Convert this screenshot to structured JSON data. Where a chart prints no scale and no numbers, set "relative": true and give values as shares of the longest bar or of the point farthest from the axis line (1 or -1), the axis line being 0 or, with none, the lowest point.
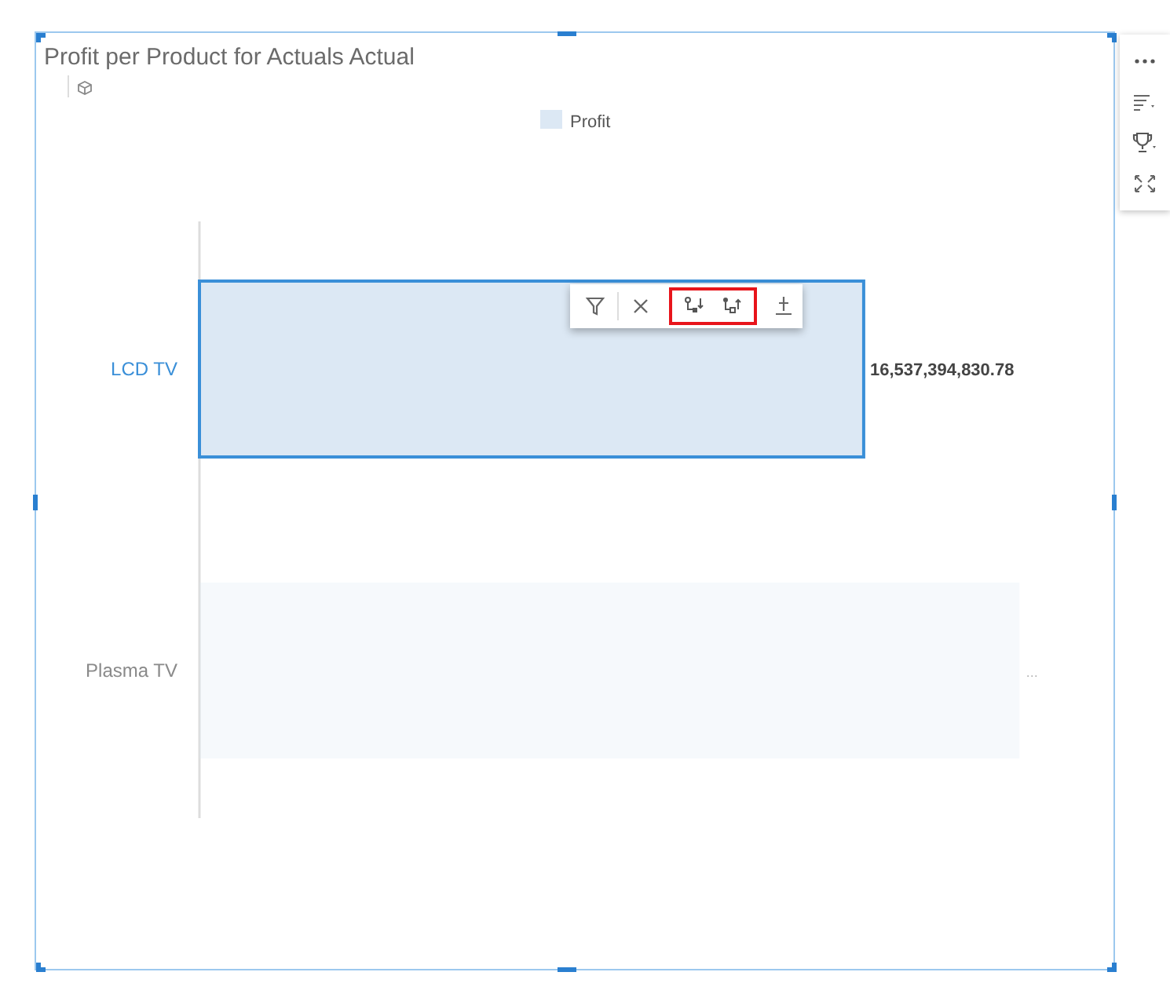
{
  "widget": {
    "title": "Profit per Product for Actuals Actual"
  },
  "chart": {
    "chart_data": {
      "type": "bar",
      "orientation": "horizontal",
      "relative": true,
      "categories": [
        "LCD TV",
        "Plasma TV"
      ],
      "series": [
        {
          "name": "Profit",
          "color": "#dce8f4",
          "values": [
            0.81,
            1
          ]
        }
      ],
      "value_labels": [
        "16,537,394,830.78",
        "…"
      ]
    },
    "bar_states": [
      {
        "selected": true
      },
      {
        "selected": false
      }
    ]
  }
}
